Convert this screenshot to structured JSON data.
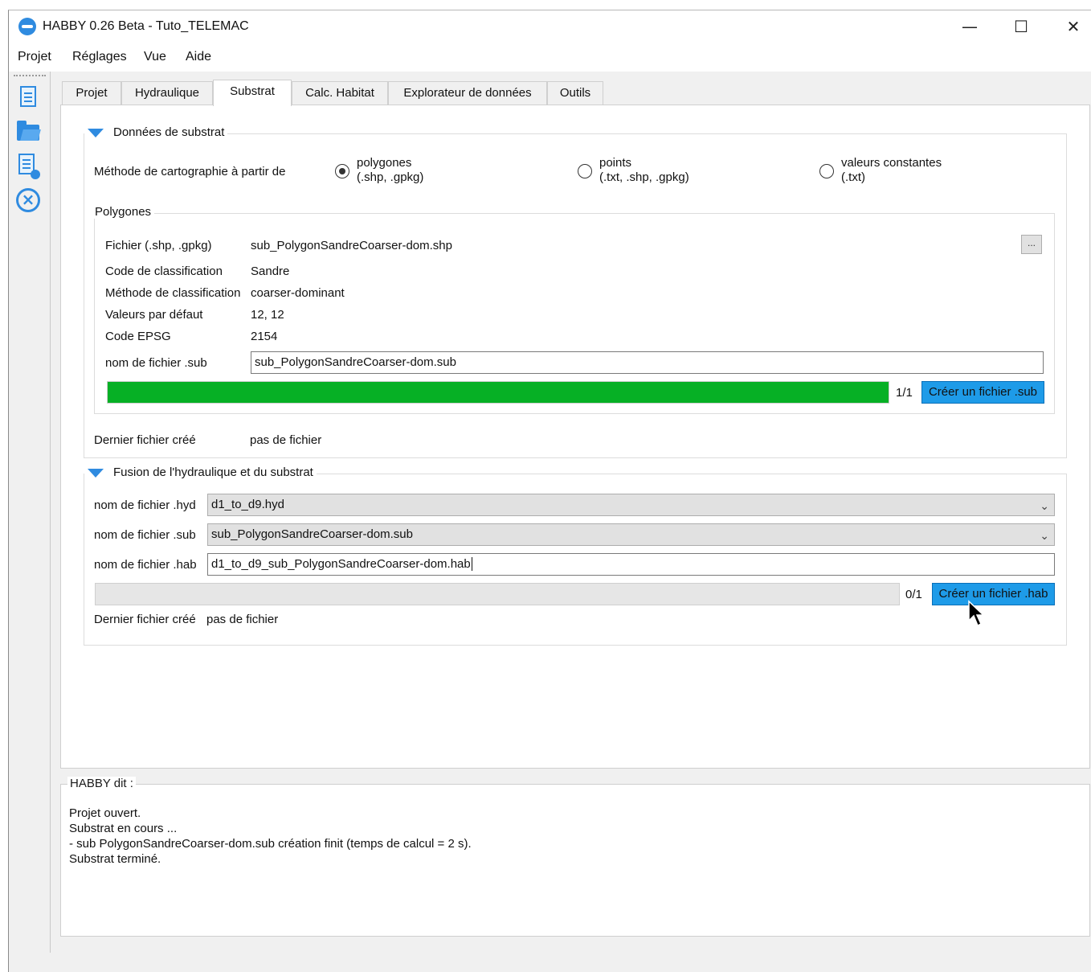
{
  "window": {
    "title": "HABBY 0.26 Beta - Tuto_TELEMAC",
    "controls": {
      "minimize": "—",
      "maximize": "☐",
      "close": "✕"
    }
  },
  "menu": [
    "Projet",
    "Réglages",
    "Vue",
    "Aide"
  ],
  "toolbar": {
    "icons": [
      "new-project-icon",
      "open-project-icon",
      "project-docs-icon",
      "close-project-icon"
    ]
  },
  "tabs": [
    "Projet",
    "Hydraulique",
    "Substrat",
    "Calc. Habitat",
    "Explorateur de données",
    "Outils"
  ],
  "active_tab": "Substrat",
  "substrate": {
    "title": "Données de substrat",
    "method_label": "Méthode de cartographie à partir de",
    "options": [
      {
        "line1": "polygones",
        "line2": "(.shp, .gpkg)",
        "checked": true
      },
      {
        "line1": "points",
        "line2": "(.txt, .shp, .gpkg)",
        "checked": false
      },
      {
        "line1": "valeurs constantes",
        "line2": "(.txt)",
        "checked": false
      }
    ],
    "polygons": {
      "title": "Polygones",
      "file_label": "Fichier (.shp, .gpkg)",
      "file_value": "sub_PolygonSandreCoarser-dom.shp",
      "browse_label": "...",
      "code_label": "Code de classification",
      "code_value": "Sandre",
      "method_label": "Méthode de classification",
      "method_value": "coarser-dominant",
      "default_label": "Valeurs par défaut",
      "default_value": "12, 12",
      "epsg_label": "Code EPSG",
      "epsg_value": "2154",
      "sub_label": "nom de fichier .sub",
      "sub_value": "sub_PolygonSandreCoarser-dom.sub",
      "progress_fraction": 1.0,
      "progress_text": "1/1",
      "create_button": "Créer un fichier .sub",
      "progress_color": "#06b025"
    },
    "last_label": "Dernier fichier créé",
    "last_value": "pas de fichier"
  },
  "merge": {
    "title": "Fusion de l'hydraulique et du substrat",
    "hyd_label": "nom de fichier .hyd",
    "hyd_value": "d1_to_d9.hyd",
    "sub_label": "nom de fichier .sub",
    "sub_value": "sub_PolygonSandreCoarser-dom.sub",
    "hab_label": "nom de fichier .hab",
    "hab_value": "d1_to_d9_sub_PolygonSandreCoarser-dom.hab",
    "progress_fraction": 0,
    "progress_text": "0/1",
    "create_button": "Créer un fichier .hab",
    "last_label": "Dernier fichier créé",
    "last_value": "pas de fichier"
  },
  "log": {
    "title": "HABBY dit :",
    "lines": [
      "Projet ouvert.",
      "Substrat en cours ...",
      "- sub PolygonSandreCoarser-dom.sub création finit (temps de calcul = 2 s).",
      "Substrat terminé."
    ]
  },
  "colors": {
    "accent": "#2f8be0",
    "button_blue": "#1e9be8",
    "progress_green": "#06b025"
  }
}
